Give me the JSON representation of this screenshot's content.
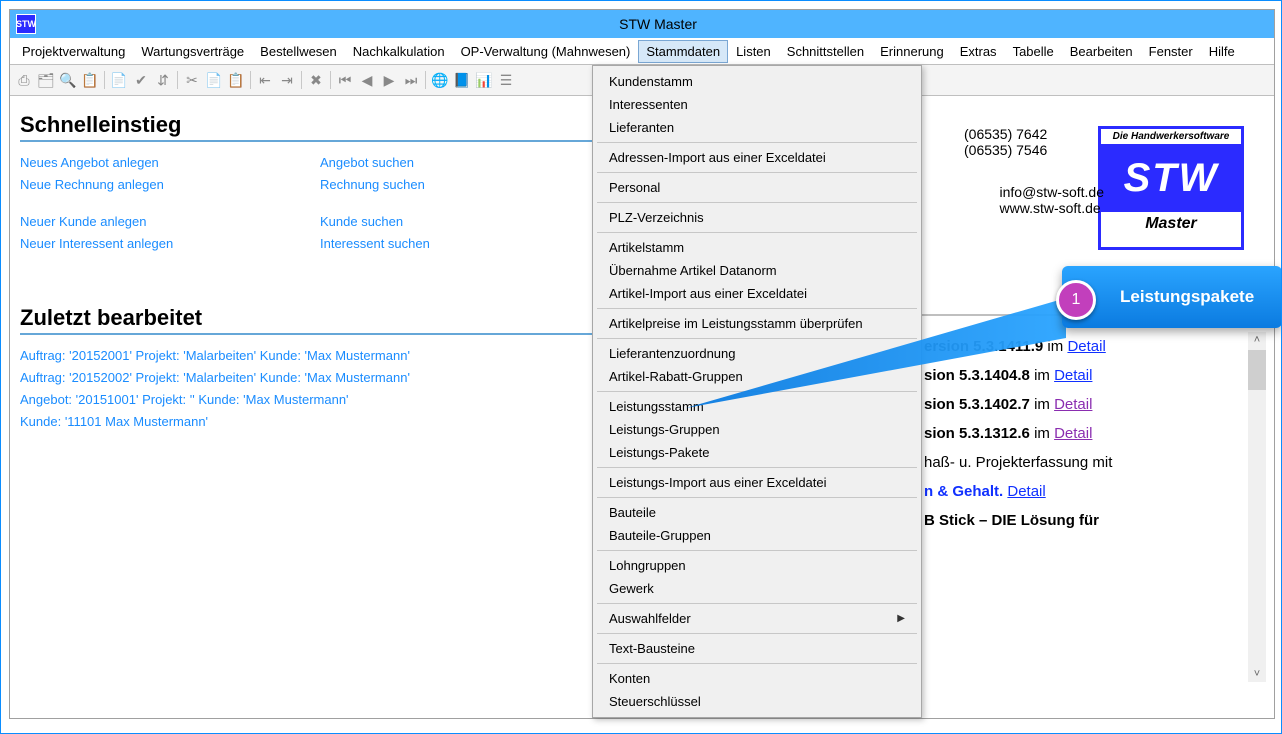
{
  "app": {
    "title": "STW Master",
    "icon_text": "STW"
  },
  "menubar": {
    "items": [
      "Projektverwaltung",
      "Wartungsverträge",
      "Bestellwesen",
      "Nachkalkulation",
      "OP-Verwaltung (Mahnwesen)",
      "Stammdaten",
      "Listen",
      "Schnittstellen",
      "Erinnerung",
      "Extras",
      "Tabelle",
      "Bearbeiten",
      "Fenster",
      "Hilfe"
    ],
    "active_index": 5
  },
  "dropdown": {
    "groups": [
      [
        "Kundenstamm",
        "Interessenten",
        "Lieferanten"
      ],
      [
        "Adressen-Import aus einer Exceldatei"
      ],
      [
        "Personal"
      ],
      [
        "PLZ-Verzeichnis"
      ],
      [
        "Artikelstamm",
        "Übernahme Artikel Datanorm",
        "Artikel-Import aus einer Exceldatei"
      ],
      [
        "Artikelpreise im Leistungsstamm überprüfen"
      ],
      [
        "Lieferantenzuordnung",
        "Artikel-Rabatt-Gruppen"
      ],
      [
        "Leistungsstamm",
        "Leistungs-Gruppen",
        "Leistungs-Pakete"
      ],
      [
        "Leistungs-Import aus einer Exceldatei"
      ],
      [
        "Bauteile",
        "Bauteile-Gruppen"
      ],
      [
        "Lohngruppen",
        "Gewerk"
      ],
      [
        "Auswahlfelder"
      ],
      [
        "Text-Bausteine"
      ],
      [
        "Konten",
        "Steuerschlüssel"
      ]
    ],
    "submenu_items": [
      "Auswahlfelder"
    ]
  },
  "left_panel": {
    "section1_title": "Schnelleinstieg",
    "colA": [
      "Neues Angebot anlegen",
      "Neue Rechnung anlegen",
      "",
      "Neuer Kunde anlegen",
      "Neuer Interessent anlegen"
    ],
    "colB": [
      "Angebot suchen",
      "Rechnung suchen",
      "",
      "Kunde suchen",
      "Interessent suchen"
    ],
    "section2_title": "Zuletzt bearbeitet",
    "recent": [
      "Auftrag: '20152001' Projekt: 'Malarbeiten' Kunde: 'Max Mustermann'",
      "Auftrag: '20152002' Projekt: 'Malarbeiten' Kunde: 'Max Mustermann'",
      "Angebot: '20151001' Projekt: '' Kunde: 'Max Mustermann'",
      "Kunde: '11101 Max Mustermann'"
    ]
  },
  "contact": {
    "phone1": "(06535) 7642",
    "phone2": "(06535) 7546",
    "email": "info@stw-soft.de",
    "web": "www.stw-soft.de"
  },
  "logo": {
    "slogan": "Die Handwerkersoftware",
    "brand": "STW",
    "product": "Master"
  },
  "news": {
    "lines": [
      {
        "prefix": "ersion ",
        "version": "5.3.1411.9",
        "suffix": " im ",
        "link": "Detail",
        "visited": false
      },
      {
        "prefix": "sion ",
        "version": "5.3.1404.8",
        "suffix": " im ",
        "link": "Detail",
        "visited": false
      },
      {
        "prefix": "sion ",
        "version": "5.3.1402.7",
        "suffix": " im ",
        "link": "Detail",
        "visited": true
      },
      {
        "prefix": "sion ",
        "version": "5.3.1312.6",
        "suffix": " im ",
        "link": "Detail",
        "visited": true
      }
    ],
    "tail1": "haß- u. Projekterfassung mit",
    "tail2_a": "n & Gehalt.",
    "tail2_link": "Detail",
    "tail3": "B Stick – DIE Lösung für"
  },
  "callout": {
    "badge": "1",
    "label": "Leistungspakete"
  },
  "toolbar_icons": [
    "⎙",
    "🗂",
    "🔍",
    "📋",
    "",
    "📄",
    "✔",
    "⇵",
    "",
    "✂",
    "📄",
    "📋",
    "",
    "⇤",
    "⇥",
    "",
    "✖",
    "",
    "⏮",
    "◀",
    "▶",
    "⏭",
    "",
    "🌐",
    "📘",
    "📊",
    "☰"
  ]
}
